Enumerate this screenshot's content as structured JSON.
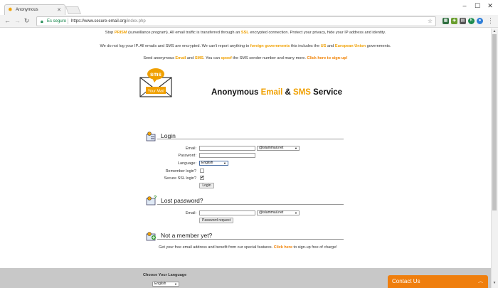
{
  "browser": {
    "tab_title": "Anonymous",
    "secure_label": "Es seguro",
    "url_base": "https://www.secure-email.org",
    "url_path": "/index.php",
    "window_controls": [
      "minimize",
      "maximize",
      "close"
    ],
    "extensions": [
      {
        "name": "extension-icon",
        "color": "#2f6f3f",
        "glyph": "▦"
      },
      {
        "name": "extension-icon",
        "color": "#6a9e2f",
        "glyph": "◈"
      },
      {
        "name": "extension-icon",
        "color": "#1b8a4c",
        "glyph": "K"
      },
      {
        "name": "extension-icon",
        "color": "#2f7ed8",
        "glyph": "●"
      }
    ]
  },
  "notices": {
    "line1": {
      "text1": "Stop ",
      "prism": "PRISM",
      "text2": " (surveillance program). All email traffic is transferred through an ",
      "ssl": "SSL",
      "text3": " encrypted connection. Protect your privacy, hide your IP address and identity."
    },
    "line2": {
      "text1": "We do not log your IP. All emails and SMS are encrypted. We can't report anything to ",
      "foreign": "foreign governments",
      "text2": " this includes the ",
      "us": "US",
      "text3": " and ",
      "eu": "European Union",
      "text4": " governments."
    },
    "line3": {
      "text1": "Send anonymous ",
      "email": "Email",
      "text2": " and ",
      "sms": "SMS",
      "text3": ". You can ",
      "spoof": "spoof",
      "text4": " the SMS sender number and many more. ",
      "signup": "Click here to sign-up!"
    }
  },
  "logo": {
    "bubble_text": "sms",
    "mail_text": "Your Mail"
  },
  "service_title": {
    "part1": "Anonymous ",
    "email": "Email",
    "part2": " & ",
    "sms": "SMS",
    "part3": " Service"
  },
  "login": {
    "title": "Login",
    "email_label": "Email:",
    "email_value": "",
    "domain_selected": "@islammail.net",
    "password_label": "Password:",
    "language_label": "Language:",
    "language_selected": "English",
    "remember_label": "Remember login?",
    "remember_checked": false,
    "ssl_label": "Secure SSL login?",
    "ssl_checked": true,
    "ssl_check_glyph": "✔",
    "button": "Login"
  },
  "lost_password": {
    "title": "Lost password?",
    "email_label": "Email:",
    "domain_selected": "@islammail.net",
    "button": "Password request"
  },
  "signup": {
    "title": "Not a member yet?",
    "text1": "Get your free email address and benefit from our special features. ",
    "link": "Click here",
    "text2": " to sign-up free of charge!"
  },
  "footer": {
    "lang_title": "Choose Your Language",
    "lang_selected": "English"
  },
  "contact": {
    "label": "Contact Us"
  },
  "colors": {
    "accent": "#f0a000",
    "contact_bg": "#ef7e0d",
    "footer_bg": "#c8c8c8"
  }
}
